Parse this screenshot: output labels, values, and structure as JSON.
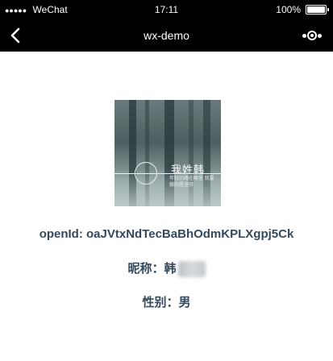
{
  "status_bar": {
    "signal_dots": "●●●●●",
    "carrier": "WeChat",
    "time": "17:11",
    "battery_text": "100%"
  },
  "nav": {
    "title": "wx-demo"
  },
  "avatar": {
    "title": "我姓韩",
    "subtitle": "年轻的路在哪里 我要做的是坚持"
  },
  "info": {
    "openid_label": "openId: ",
    "openid_value": "oaJVtxNdTecBaBhOdmKPLXgpj5Ck",
    "nickname_label": "昵称：",
    "nickname_visible": "韩",
    "gender_label": "性别：",
    "gender_value": "男"
  }
}
